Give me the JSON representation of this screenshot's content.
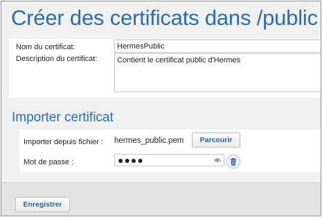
{
  "page": {
    "title": "Créer des certificats dans /public"
  },
  "certificate": {
    "name_label": "Nom du certificat:",
    "name_value": "HermesPublic",
    "description_label": "Description du certificat:",
    "description_value": "Contient le certificat public d'Hermes"
  },
  "import": {
    "title": "Importer certificat",
    "file_label": "Importer depuis fichier :",
    "file_name": "hermes_public.pem",
    "browse_label": "Parcourir",
    "password_label": "Mot de passe :",
    "password_mask": "●●●●"
  },
  "footer": {
    "save_label": "Enregistrer"
  },
  "colors": {
    "accent": "#2a6db5",
    "button_text": "#1f63a8"
  },
  "icons": {
    "eye": "eye-icon",
    "trash": "trash-icon"
  }
}
